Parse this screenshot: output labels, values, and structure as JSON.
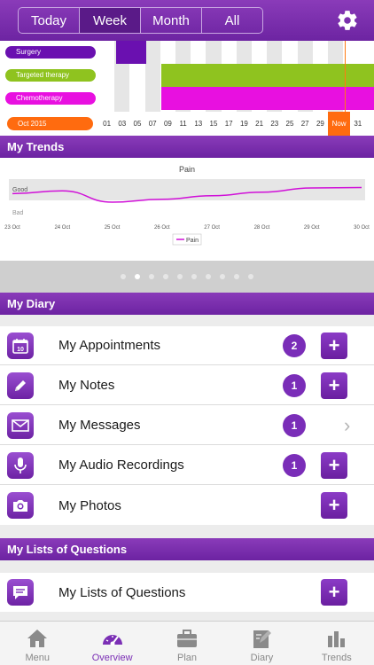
{
  "header": {
    "segments": [
      "Today",
      "Week",
      "Month",
      "All"
    ],
    "active_segment": "Week"
  },
  "timeline": {
    "rows": [
      {
        "label": "Surgery",
        "color": "#6a10b0"
      },
      {
        "label": "Targeted therapy",
        "color": "#8fc31f"
      },
      {
        "label": "Chemotherapy",
        "color": "#e810e0"
      }
    ],
    "month": "Oct 2015",
    "dates": [
      "01",
      "03",
      "05",
      "07",
      "09",
      "11",
      "13",
      "15",
      "17",
      "19",
      "21",
      "23",
      "25",
      "27",
      "29",
      "Now",
      "31"
    ],
    "now_color": "#ff6b0f"
  },
  "sections": {
    "trends": "My Trends",
    "diary": "My Diary",
    "questions": "My Lists of Questions"
  },
  "chart_data": {
    "type": "line",
    "title": "Pain",
    "x": [
      "23 Oct",
      "24 Oct",
      "25 Oct",
      "26 Oct",
      "27 Oct",
      "28 Oct",
      "29 Oct",
      "30 Oct"
    ],
    "y_categories": [
      "Good",
      "Bad"
    ],
    "series": [
      {
        "name": "Pain",
        "color": "#d010d8",
        "values": [
          0.35,
          0.55,
          -0.25,
          -0.05,
          0.2,
          0.45,
          0.75,
          0.78
        ]
      }
    ],
    "ylim": [
      -1,
      1
    ],
    "legend": "bottom-center",
    "grid": false
  },
  "pager": {
    "count": 10,
    "active": 1
  },
  "diary": [
    {
      "label": "My Appointments",
      "icon": "calendar-icon",
      "icon_text": "10",
      "badge": "2",
      "action": "plus"
    },
    {
      "label": "My Notes",
      "icon": "pencil-icon",
      "badge": "1",
      "action": "plus"
    },
    {
      "label": "My Messages",
      "icon": "envelope-icon",
      "badge": "1",
      "action": "chevron"
    },
    {
      "label": "My Audio Recordings",
      "icon": "microphone-icon",
      "badge": "1",
      "action": "plus"
    },
    {
      "label": "My Photos",
      "icon": "camera-icon",
      "badge": "",
      "action": "plus"
    }
  ],
  "questions": [
    {
      "label": "My Lists of Questions",
      "icon": "chat-icon",
      "action": "plus"
    }
  ],
  "plus_symbol": "+",
  "chevron_symbol": "›",
  "tabs": [
    {
      "label": "Menu",
      "icon": "home-icon"
    },
    {
      "label": "Overview",
      "icon": "speedometer-icon"
    },
    {
      "label": "Plan",
      "icon": "briefcase-icon"
    },
    {
      "label": "Diary",
      "icon": "notebook-icon"
    },
    {
      "label": "Trends",
      "icon": "bar-chart-icon"
    }
  ],
  "active_tab": "Overview"
}
